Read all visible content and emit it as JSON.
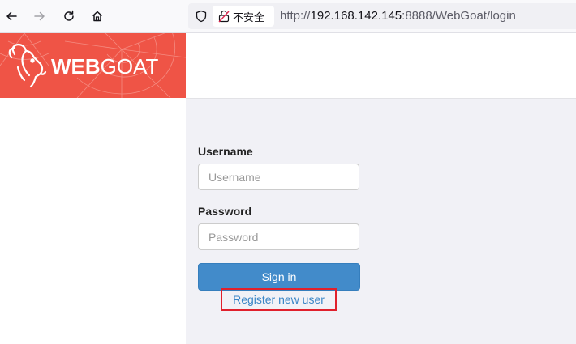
{
  "browser": {
    "security_label": "不安全",
    "url_prefix": "http://",
    "url_host": "192.168.142.145",
    "url_rest": ":8888/WebGoat/login"
  },
  "brand": {
    "name_bold": "WEB",
    "name_light": "GOAT"
  },
  "form": {
    "username_label": "Username",
    "username_placeholder": "Username",
    "username_value": "",
    "password_label": "Password",
    "password_placeholder": "Password",
    "password_value": "",
    "signin_label": "Sign in",
    "register_label": "Register new user"
  }
}
